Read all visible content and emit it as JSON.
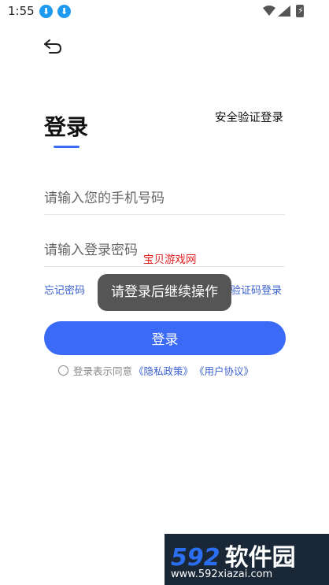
{
  "status_bar": {
    "time": "1:55",
    "icons": [
      "download-icon",
      "download-icon",
      "wifi-icon",
      "signal-icon",
      "battery-icon"
    ]
  },
  "header": {
    "back_icon": "back-arrow-icon"
  },
  "login": {
    "title": "登录",
    "secure_login_label": "安全验证登录",
    "phone_placeholder": "请输入您的手机号码",
    "password_placeholder": "请输入登录密码",
    "forgot_password_label": "忘记密码",
    "code_login_label": "验证码登录",
    "login_button_label": "登录",
    "agreement_text": "登录表示同意",
    "privacy_policy_label": "《隐私政策》",
    "user_agreement_label": "《用户协议》"
  },
  "toast": {
    "message": "请登录后继续操作"
  },
  "watermarks": {
    "red_text": "宝贝游戏网",
    "logo_number": "592",
    "logo_text": "软件园",
    "logo_url": "www.592xiazai.com"
  },
  "colors": {
    "accent": "#3b6bf6",
    "link": "#3a5fcf",
    "toast_bg": "#555555",
    "watermark_red": "#e02020"
  }
}
